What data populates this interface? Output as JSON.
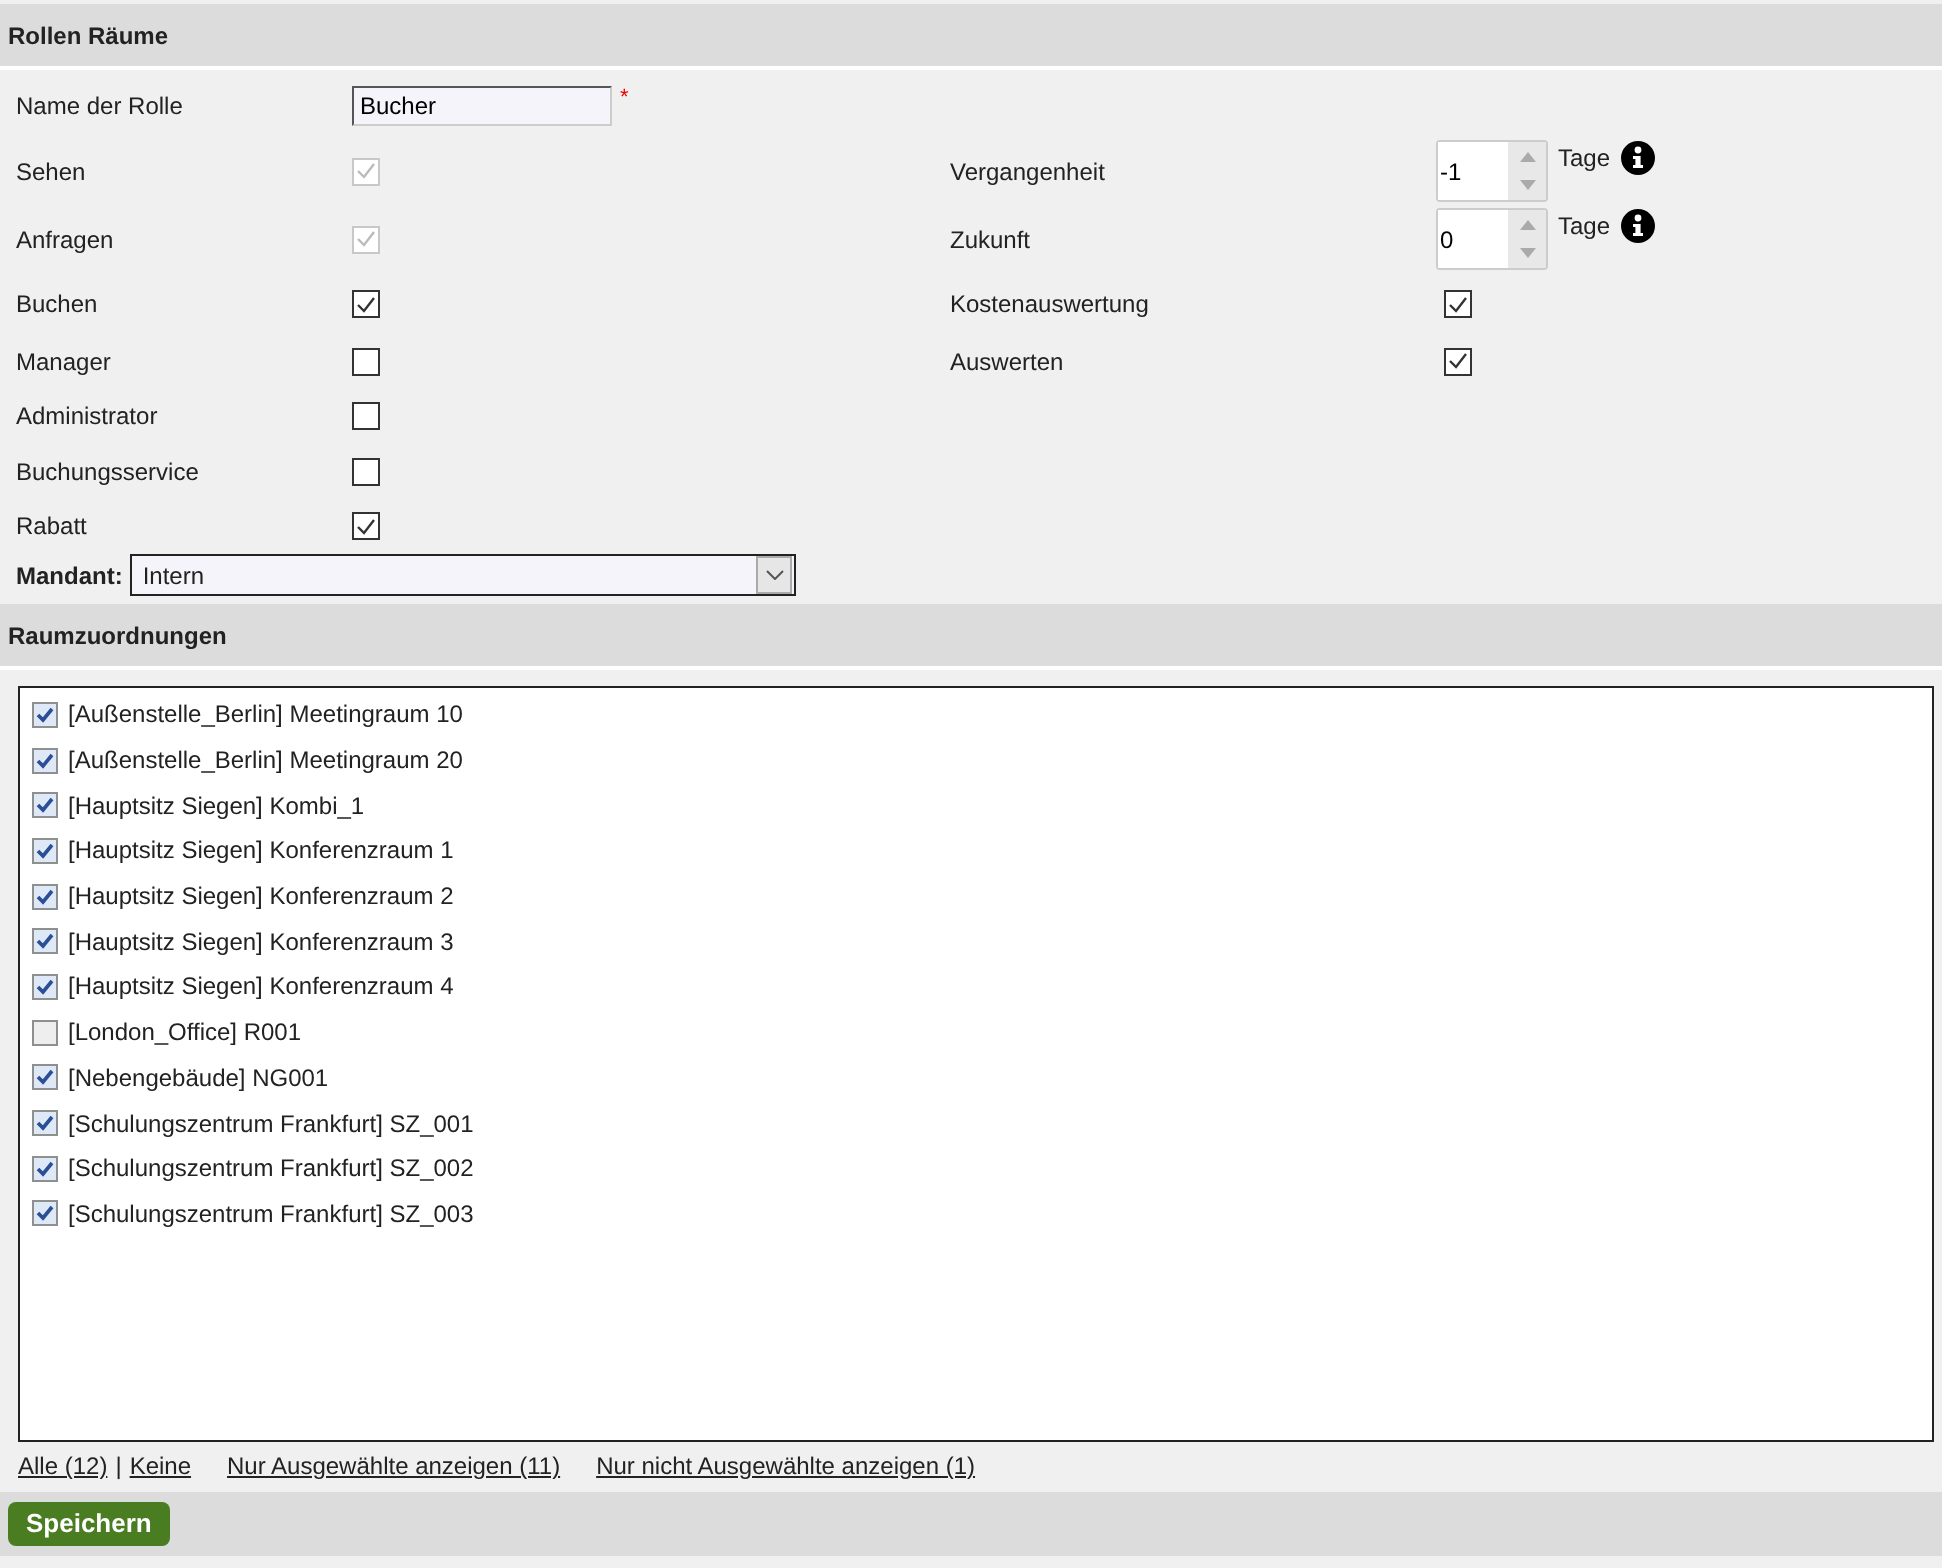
{
  "title": "Rollen Räume",
  "name_field": {
    "label": "Name der Rolle",
    "value": "Bucher",
    "required_mark": "*"
  },
  "permissions": [
    {
      "label": "Sehen",
      "checked": true,
      "disabled": true
    },
    {
      "label": "Anfragen",
      "checked": true,
      "disabled": true
    },
    {
      "label": "Buchen",
      "checked": true,
      "disabled": false
    },
    {
      "label": "Manager",
      "checked": false,
      "disabled": false
    },
    {
      "label": "Administrator",
      "checked": false,
      "disabled": false
    },
    {
      "label": "Buchungsservice",
      "checked": false,
      "disabled": false
    },
    {
      "label": "Rabatt",
      "checked": true,
      "disabled": false
    }
  ],
  "options": [
    {
      "kind": "number",
      "label": "Vergangenheit",
      "value": "-1",
      "unit": "Tage"
    },
    {
      "kind": "number",
      "label": "Zukunft",
      "value": "0",
      "unit": "Tage"
    },
    {
      "kind": "checkbox",
      "label": "Kostenauswertung",
      "checked": true
    },
    {
      "kind": "checkbox",
      "label": "Auswerten",
      "checked": true
    }
  ],
  "mandant": {
    "label": "Mandant:",
    "value": "Intern"
  },
  "rooms_title": "Raumzuordnungen",
  "rooms": [
    {
      "label": "[Außenstelle_Berlin] Meetingraum 10",
      "checked": true
    },
    {
      "label": "[Außenstelle_Berlin] Meetingraum 20",
      "checked": true
    },
    {
      "label": "[Hauptsitz Siegen] Kombi_1",
      "checked": true
    },
    {
      "label": "[Hauptsitz Siegen] Konferenzraum 1",
      "checked": true
    },
    {
      "label": "[Hauptsitz Siegen] Konferenzraum 2",
      "checked": true
    },
    {
      "label": "[Hauptsitz Siegen] Konferenzraum 3",
      "checked": true
    },
    {
      "label": "[Hauptsitz Siegen] Konferenzraum 4",
      "checked": true
    },
    {
      "label": "[London_Office] R001",
      "checked": false
    },
    {
      "label": "[Nebengebäude] NG001",
      "checked": true
    },
    {
      "label": "[Schulungszentrum Frankfurt] SZ_001",
      "checked": true
    },
    {
      "label": "[Schulungszentrum Frankfurt] SZ_002",
      "checked": true
    },
    {
      "label": "[Schulungszentrum Frankfurt] SZ_003",
      "checked": true
    }
  ],
  "links": {
    "all": "Alle (12)",
    "separator": "|",
    "none": "Keine",
    "only_selected": "Nur Ausgewählte anzeigen (11)",
    "only_unselected": "Nur nicht Ausgewählte anzeigen (1)"
  },
  "save_button": "Speichern"
}
